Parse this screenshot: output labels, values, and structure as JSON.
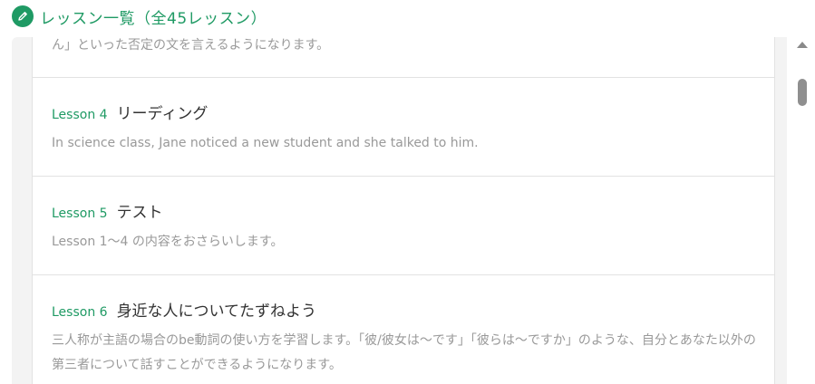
{
  "header": {
    "title": "レッスン一覧（全45レッスン）",
    "icon": "pencil-icon",
    "accent_color": "#1f9a64"
  },
  "lessons": [
    {
      "number": "",
      "title": "",
      "description": "ん」といった否定の文を言えるようになります。"
    },
    {
      "number": "Lesson 4",
      "title": "リーディング",
      "description": "In science class, Jane noticed a new student and she talked to him."
    },
    {
      "number": "Lesson 5",
      "title": "テスト",
      "description": "Lesson 1～4 の内容をおさらいします。"
    },
    {
      "number": "Lesson 6",
      "title": "身近な人についてたずねよう",
      "description": "三人称が主語の場合のbe動詞の使い方を学習します。「彼/彼女は～です」「彼らは～ですか」のような、自分とあなた以外の第三者について話すことができるようになります。"
    }
  ],
  "scrollbar": {
    "up_icon": "triangle-up-icon"
  }
}
